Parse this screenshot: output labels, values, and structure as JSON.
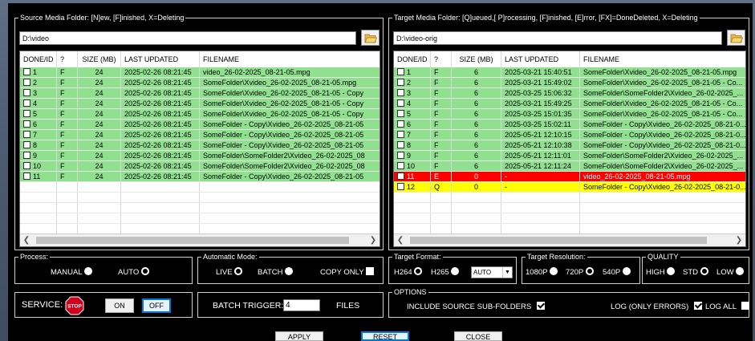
{
  "source": {
    "title": "Source Media Folder: [N]ew, [F]inished, X=Deleting",
    "path": "D:\\video",
    "columns": [
      "DONE/ID",
      "?",
      "SIZE (MB)",
      "LAST UPDATED",
      "FILENAME"
    ],
    "rows": [
      {
        "id": "1",
        "status": "F",
        "size": "24",
        "updated": "2025-02-26 08:21:45",
        "filename": "video_26-02-2025_08-21-05.mpg",
        "color": "green"
      },
      {
        "id": "2",
        "status": "F",
        "size": "24",
        "updated": "2025-02-26 08:21:45",
        "filename": "SomeFolder\\Xvideo_26-02-2025_08-21-05.mpg",
        "color": "green"
      },
      {
        "id": "3",
        "status": "F",
        "size": "24",
        "updated": "2025-02-26 08:21:45",
        "filename": "SomeFolder\\Xvideo_26-02-2025_08-21-05 - Copy",
        "color": "green"
      },
      {
        "id": "4",
        "status": "F",
        "size": "24",
        "updated": "2025-02-26 08:21:45",
        "filename": "SomeFolder\\Xvideo_26-02-2025_08-21-05 - Copy",
        "color": "green"
      },
      {
        "id": "5",
        "status": "F",
        "size": "24",
        "updated": "2025-02-26 08:21:45",
        "filename": "SomeFolder\\Xvideo_26-02-2025_08-21-05 - Copy",
        "color": "green"
      },
      {
        "id": "6",
        "status": "F",
        "size": "24",
        "updated": "2025-02-26 08:21:45",
        "filename": "SomeFolder - Copy\\Xvideo_26-02-2025_08-21-05",
        "color": "green"
      },
      {
        "id": "7",
        "status": "F",
        "size": "24",
        "updated": "2025-02-26 08:21:45",
        "filename": "SomeFolder - Copy\\Xvideo_26-02-2025_08-21-05",
        "color": "green"
      },
      {
        "id": "8",
        "status": "F",
        "size": "24",
        "updated": "2025-02-26 08:21:45",
        "filename": "SomeFolder - Copy\\Xvideo_26-02-2025_08-21-05",
        "color": "green"
      },
      {
        "id": "9",
        "status": "F",
        "size": "24",
        "updated": "2025-02-26 08:21:45",
        "filename": "SomeFolder\\SomeFolder2\\Xvideo_26-02-2025_08",
        "color": "green"
      },
      {
        "id": "10",
        "status": "F",
        "size": "24",
        "updated": "2025-02-26 08:21:45",
        "filename": "SomeFolder\\SomeFolder2\\Xvideo_26-02-2025_08",
        "color": "green"
      },
      {
        "id": "11",
        "status": "F",
        "size": "24",
        "updated": "2025-02-26 08:21:45",
        "filename": "SomeFolder - Copy\\Xvideo_26-02-2025_08-21-05",
        "color": "green"
      }
    ],
    "empty_rows": 6
  },
  "target": {
    "title": "Target Media Folder: [Q]ueued,[ P]rocessing, [F]inished, [E]rror, [FX]=DoneDeleted, X=Deleting",
    "path": "D:\\video-orig",
    "columns": [
      "DONE/ID",
      "?",
      "SIZE (MB)",
      "LAST UPDATED",
      "FILENAME"
    ],
    "rows": [
      {
        "id": "1",
        "status": "F",
        "size": "6",
        "updated": "2025-03-21 15:40:51",
        "filename": "SomeFolder\\Xvideo_26-02-2025_08-21-05.mpg",
        "color": "green"
      },
      {
        "id": "2",
        "status": "F",
        "size": "6",
        "updated": "2025-03-21 15:49:02",
        "filename": "SomeFolder\\Xvideo_26-02-2025_08-21-05 - Co...",
        "color": "green"
      },
      {
        "id": "3",
        "status": "F",
        "size": "6",
        "updated": "2025-03-25 15:06:32",
        "filename": "SomeFolder\\SomeFolder2\\Xvideo_26-02-2025_...",
        "color": "green"
      },
      {
        "id": "4",
        "status": "F",
        "size": "6",
        "updated": "2025-03-21 15:49:25",
        "filename": "SomeFolder\\Xvideo_26-02-2025_08-21-05 - Co...",
        "color": "green"
      },
      {
        "id": "5",
        "status": "F",
        "size": "6",
        "updated": "2025-03-25 15:01:35",
        "filename": "SomeFolder\\Xvideo_26-02-2025_08-21-05 - Co...",
        "color": "green"
      },
      {
        "id": "6",
        "status": "F",
        "size": "6",
        "updated": "2025-03-25 15:02:11",
        "filename": "SomeFolder - Copy\\Xvideo_26-02-2025_08-21-0...",
        "color": "green"
      },
      {
        "id": "7",
        "status": "F",
        "size": "6",
        "updated": "2025-05-21 12:10:15",
        "filename": "SomeFolder - Copy\\Xvideo_26-02-2025_08-21-0...",
        "color": "green"
      },
      {
        "id": "8",
        "status": "F",
        "size": "6",
        "updated": "2025-05-21 12:10:38",
        "filename": "SomeFolder - Copy\\Xvideo_26-02-2025_08-21-0...",
        "color": "green"
      },
      {
        "id": "9",
        "status": "F",
        "size": "6",
        "updated": "2025-05-21 12:11:01",
        "filename": "SomeFolder\\SomeFolder2\\Xvideo_26-02-2025_...",
        "color": "green"
      },
      {
        "id": "10",
        "status": "F",
        "size": "6",
        "updated": "2025-05-21 12:11:24",
        "filename": "SomeFolder\\SomeFolder2\\Xvideo_26-02-2025_...",
        "color": "green"
      },
      {
        "id": "11",
        "status": "E",
        "size": "0",
        "updated": "-",
        "filename": "video_26-02-2025_08-21-05.mpg",
        "color": "red"
      },
      {
        "id": "12",
        "status": "Q",
        "size": "0",
        "updated": "-",
        "filename": "SomeFolder - Copy\\Xvideo_26-02-2025_08-21-0...",
        "color": "yellow"
      }
    ],
    "empty_rows": 5
  },
  "process": {
    "title": "Process:",
    "manual": "MANUAL",
    "auto": "AUTO",
    "selected": "auto"
  },
  "auto_mode": {
    "title": "Automatic Mode:",
    "live": "LIVE",
    "batch": "BATCH",
    "copy_only": "COPY ONLY",
    "selected": "live"
  },
  "target_format": {
    "title": "Target Format:",
    "h264": "H264",
    "h265": "H265",
    "dropdown": "AUTO",
    "selected": "h264"
  },
  "target_resolution": {
    "title": "Target Resolution:",
    "r1080": "1080P",
    "r720": "720P",
    "r540": "540P",
    "selected": "720p"
  },
  "quality": {
    "title": "QUALITY",
    "high": "HIGH",
    "std": "STD",
    "low": "LOW",
    "selected": "std"
  },
  "service": {
    "label": "SERVICE:",
    "stop_icon_text": "STOP",
    "on": "ON",
    "off": "OFF",
    "active": "off"
  },
  "batch": {
    "label": "BATCH TRIGGER:",
    "value": "4",
    "unit": "FILES"
  },
  "options": {
    "title": "OPTIONS",
    "include_sub": "INCLUDE SOURCE SUB-FOLDERS",
    "log_errors": "LOG (ONLY ERRORS)",
    "log_all": "LOG ALL"
  },
  "footer": {
    "apply": "APPLY",
    "reset": "RESET",
    "close": "CLOSE"
  },
  "colors": {
    "green": "#90e090",
    "red": "#ff0000",
    "yellow": "#ffff00",
    "stop": "#d0021b"
  }
}
